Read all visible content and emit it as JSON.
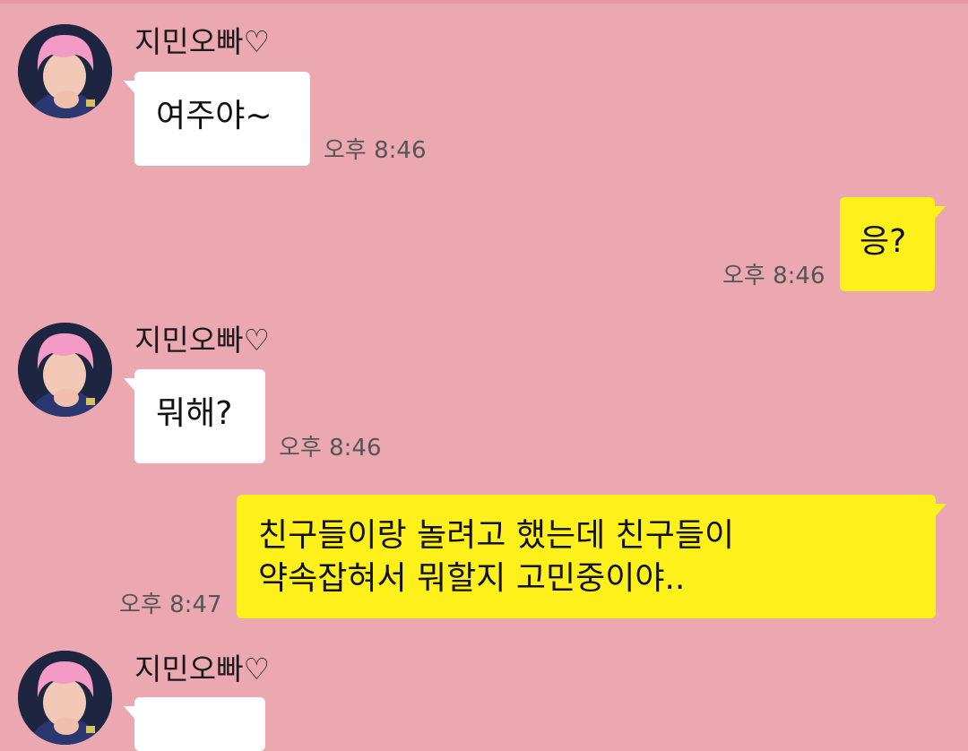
{
  "chat": {
    "contact_name": "지민오빠♡",
    "messages": [
      {
        "from": "them",
        "text": "여주야~",
        "time": "오후 8:46"
      },
      {
        "from": "me",
        "text": "응?",
        "time": "오후 8:46"
      },
      {
        "from": "them",
        "text": "뭐해?",
        "time": "오후 8:46"
      },
      {
        "from": "me",
        "lines": [
          "친구들이랑 놀려고 했는데 친구들이",
          "약속잡혀서 뭐할지 고민중이야.."
        ],
        "time": "오후 8:47"
      },
      {
        "from": "them",
        "text": "",
        "time": ""
      }
    ]
  },
  "colors": {
    "background": "#eba8b0",
    "incoming_bubble": "#ffffff",
    "outgoing_bubble": "#fef01b"
  },
  "icons": {
    "avatar": "profile-photo-pink-hair"
  }
}
